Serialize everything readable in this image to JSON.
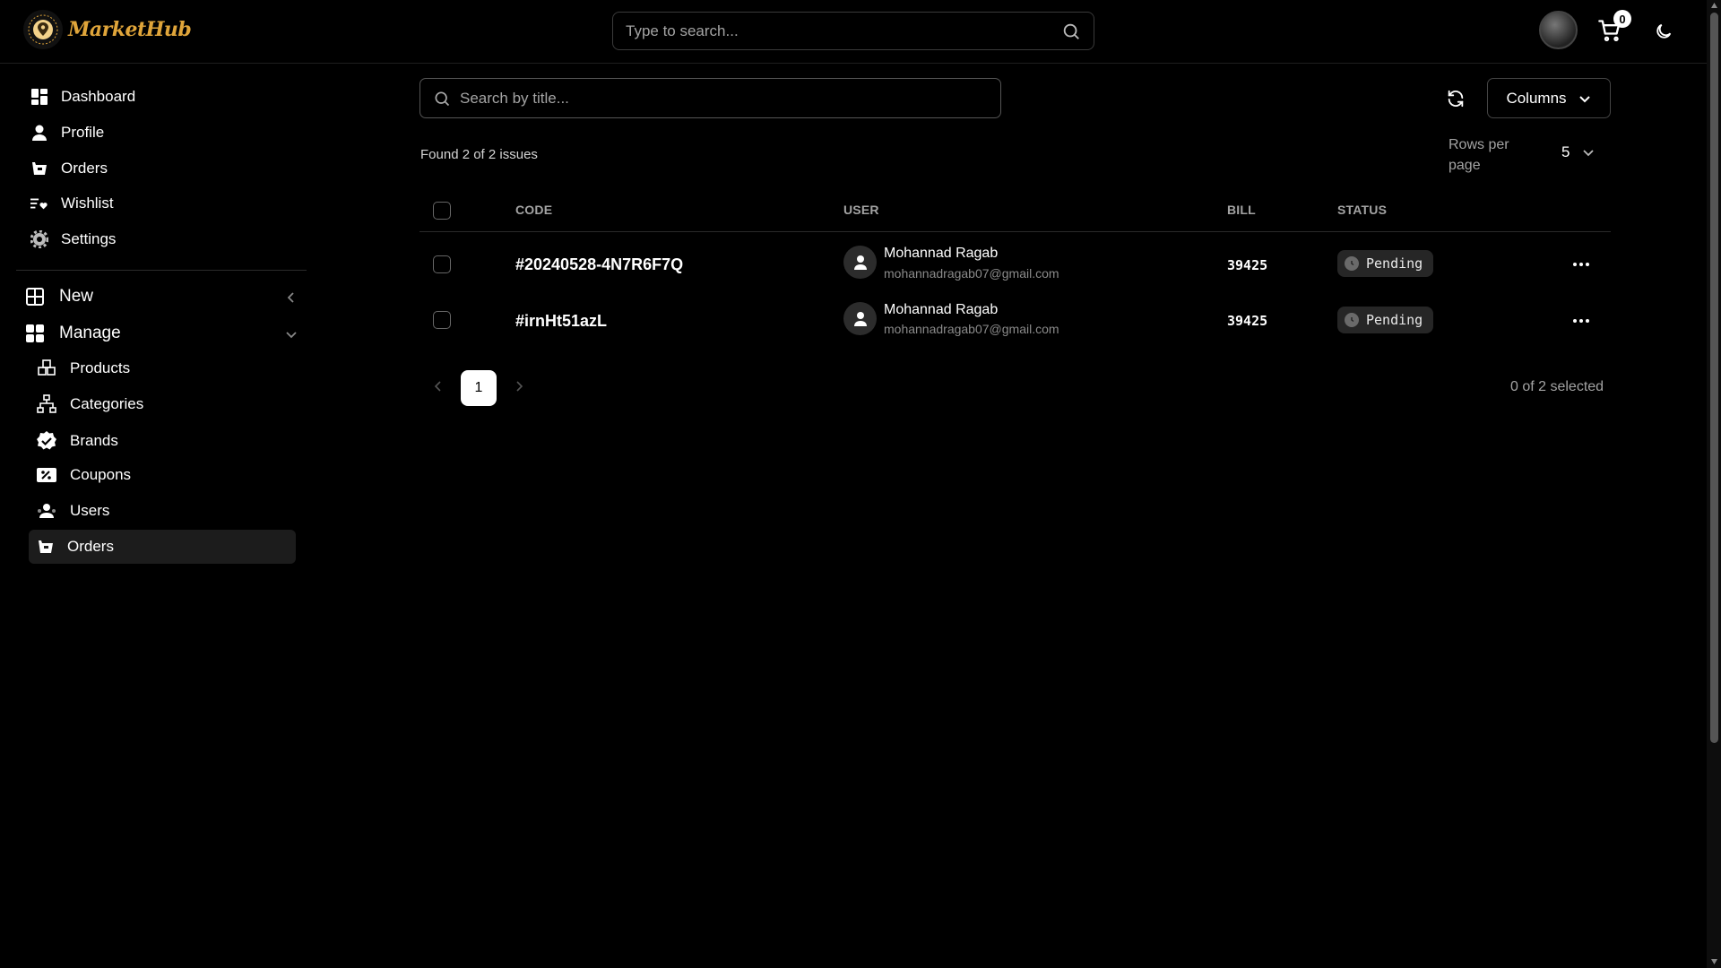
{
  "app": {
    "name": "MarketHub",
    "search_placeholder": "Type to search...",
    "cart_count": "0"
  },
  "sidebar": {
    "items": [
      {
        "label": "Dashboard",
        "icon": "dashboard-icon"
      },
      {
        "label": "Profile",
        "icon": "user-icon"
      },
      {
        "label": "Orders",
        "icon": "orders-icon"
      },
      {
        "label": "Wishlist",
        "icon": "wishlist-icon"
      },
      {
        "label": "Settings",
        "icon": "gear-icon"
      }
    ],
    "groups": {
      "new": {
        "label": "New",
        "expanded": false
      },
      "manage": {
        "label": "Manage",
        "expanded": true,
        "items": [
          {
            "label": "Products",
            "icon": "products-icon"
          },
          {
            "label": "Categories",
            "icon": "categories-icon"
          },
          {
            "label": "Brands",
            "icon": "brands-icon"
          },
          {
            "label": "Coupons",
            "icon": "coupons-icon"
          },
          {
            "label": "Users",
            "icon": "users-icon"
          },
          {
            "label": "Orders",
            "icon": "orders-icon",
            "active": true
          }
        ]
      }
    }
  },
  "main": {
    "search_placeholder": "Search by title...",
    "columns_label": "Columns",
    "found_text": "Found 2 of 2 issues",
    "rows_per_page_label": "Rows per page",
    "rows_per_page_value": "5",
    "table": {
      "headers": {
        "code": "CODE",
        "user": "USER",
        "bill": "BILL",
        "status": "STATUS"
      },
      "rows": [
        {
          "code": "#20240528-4N7R6F7Q",
          "user_name": "Mohannad Ragab",
          "user_email": "mohannadragab07@gmail.com",
          "bill": "39425",
          "status": "Pending"
        },
        {
          "code": "#irnHt51azL",
          "user_name": "Mohannad Ragab",
          "user_email": "mohannadragab07@gmail.com",
          "bill": "39425",
          "status": "Pending"
        }
      ]
    },
    "pagination": {
      "current_page": "1"
    },
    "selected_text": "0 of 2 selected"
  },
  "colors": {
    "background": "#000000",
    "logo_accent": "#e0a53a",
    "badge_bg": "#262626",
    "active_item_bg": "#1c1c1c"
  }
}
